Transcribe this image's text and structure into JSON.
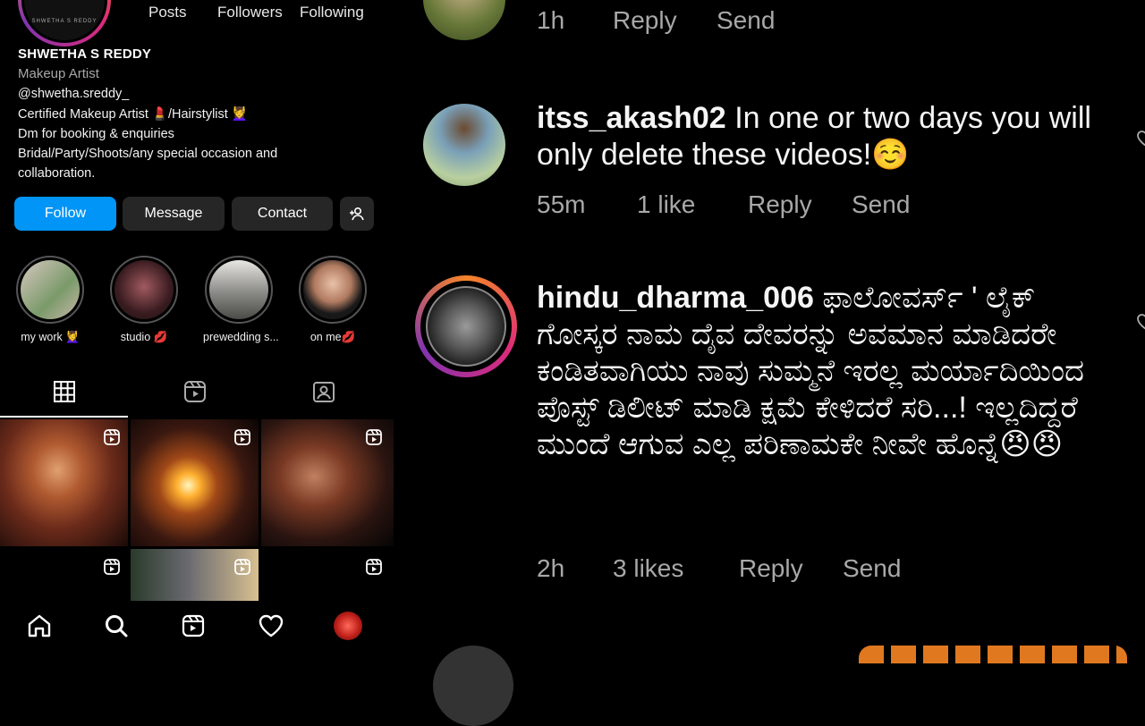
{
  "profile": {
    "stats": {
      "posts": "Posts",
      "followers": "Followers",
      "following": "Following"
    },
    "name": "SHWETHA S REDDY",
    "category": "Makeup Artist",
    "bio": [
      "@shwetha.sreddy_",
      "Certified Makeup Artist 💄/Hairstylist 💆‍♀️",
      "Dm for booking & enquiries",
      "Bridal/Party/Shoots/any special occasion and",
      "collaboration."
    ],
    "buttons": {
      "follow": "Follow",
      "message": "Message",
      "contact": "Contact"
    },
    "highlights": [
      {
        "label": "my work 💆‍♀️"
      },
      {
        "label": "studio 💋"
      },
      {
        "label": "prewedding s..."
      },
      {
        "label": "on me💋"
      }
    ]
  },
  "comments": [
    {
      "meta": {
        "time": "1h",
        "reply": "Reply",
        "send": "Send"
      }
    },
    {
      "user": "itss_akash02",
      "text": "In one or two days you will only delete these videos!☺️",
      "meta": {
        "time": "55m",
        "likes": "1 like",
        "reply": "Reply",
        "send": "Send"
      }
    },
    {
      "user": "hindu_dharma_006",
      "text": "ಫಾಲೋವರ್ಸ್ ' ಲೈಕ್ ಗೋಸ್ಕರ ನಾಮ ದೈವ ದೇವರನ್ನು ಅವಮಾನ ಮಾಡಿದರೇ ಕಂಡಿತವಾಗಿಯು ನಾವು ಸುಮ್ಮನೆ ಇರಲ್ಲ ಮರ್ಯಾದಿಯಿಂದ ಪೊಸ್ಟ್ ಡಿಲೀಟ್ ಮಾಡಿ ಕ್ಷಮೆ ಕೇಳಿದರೆ ಸರಿ...! ಇಲ್ಲದಿದ್ದರೆ ಮುಂದೆ ಆಗುವ ಎಲ್ಲ ಪರಿಣಾಮಕೇ  ನೀವೇ ಹೊನ್ನೆ😠😠",
      "meta": {
        "time": "2h",
        "likes": "3 likes",
        "reply": "Reply",
        "send": "Send"
      }
    }
  ],
  "colors": {
    "accent": "#0095f6",
    "secondary_text": "#a8a8a8",
    "button_bg": "#262626"
  }
}
